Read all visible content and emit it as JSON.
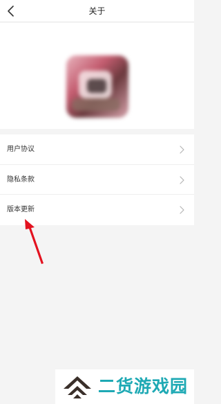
{
  "navbar": {
    "title": "关于"
  },
  "menu": {
    "items": [
      {
        "label": "用户协议"
      },
      {
        "label": "隐私条款"
      },
      {
        "label": "版本更新"
      }
    ]
  },
  "watermark": {
    "text": "二货游戏园"
  },
  "colors": {
    "arrow": "#e3121f",
    "watermark": "#1ea9b4",
    "watermark_logo": "#3a2f2a"
  },
  "icons": {
    "back": "chevron-left-icon",
    "row_arrow": "chevron-right-icon"
  }
}
